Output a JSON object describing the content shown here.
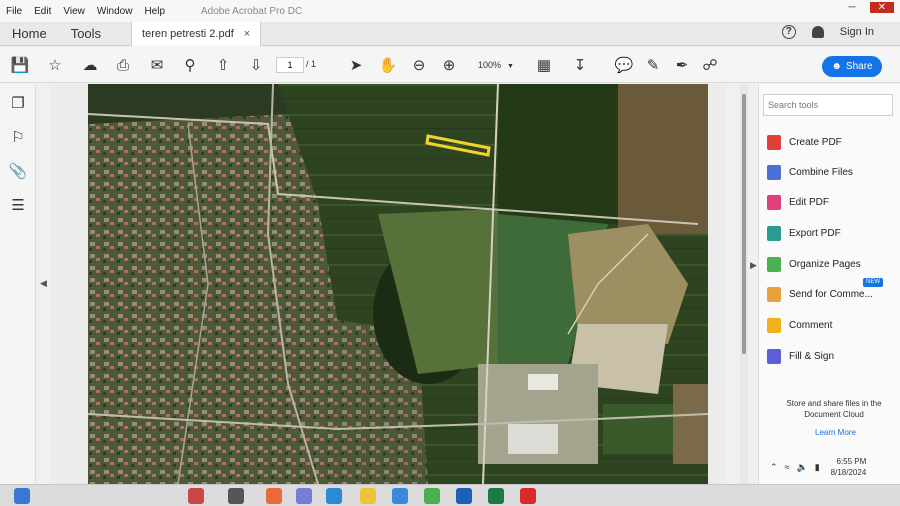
{
  "menu": {
    "items": [
      "File",
      "Edit",
      "View",
      "Window",
      "Help"
    ],
    "app_title": "Adobe Acrobat Pro DC"
  },
  "tabs": {
    "home": "Home",
    "tools": "Tools",
    "document": "teren petresti  2.pdf",
    "close_symbol": "×"
  },
  "account": {
    "sign_in": "Sign In"
  },
  "toolbar": {
    "page_current": "1",
    "page_total": "/ 1",
    "zoom": "100%",
    "share_label": "Share"
  },
  "tools_panel": {
    "search_placeholder": "Search tools",
    "items": [
      {
        "label": "Create PDF",
        "color": "#e0403a"
      },
      {
        "label": "Combine Files",
        "color": "#4a6fd6"
      },
      {
        "label": "Edit PDF",
        "color": "#e0407a"
      },
      {
        "label": "Export PDF",
        "color": "#2a9d8f"
      },
      {
        "label": "Organize Pages",
        "color": "#4caf50"
      },
      {
        "label": "Send for Comme...",
        "color": "#e6a23c"
      },
      {
        "label": "Comment",
        "color": "#f2b01e"
      },
      {
        "label": "Fill & Sign",
        "color": "#5b5fd6"
      }
    ],
    "new_badge": "NEW",
    "cloud_text": "Store and share files in the Document Cloud",
    "learn_more": "Learn More"
  },
  "systray": {
    "time": "6:55 PM",
    "date": "8/18/2024"
  },
  "colors": {
    "accent": "#1473e6",
    "parcel_outline": "#f2d22e",
    "field_dark": "#2f4a1f",
    "urban": "#6e6a5a"
  }
}
